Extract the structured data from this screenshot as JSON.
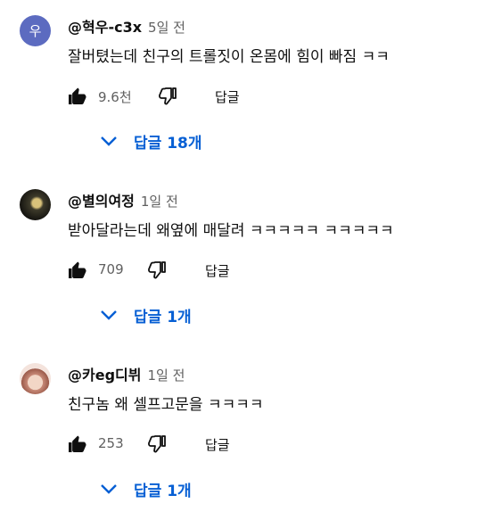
{
  "comments": [
    {
      "author": "@혁우-c3x",
      "time": "5일 전",
      "avatar_letter": "우",
      "text": "잘버텼는데 친구의 트롤짓이 온몸에 힘이 빠짐 ㅋㅋ",
      "likes": "9.6천",
      "reply_label": "답글",
      "replies_label": "답글 18개"
    },
    {
      "author": "@별의여정",
      "time": "1일 전",
      "text": "받아달라는데  왜옆에 매달려 ㅋㅋㅋㅋㅋ ㅋㅋㅋㅋㅋ",
      "likes": "709",
      "reply_label": "답글",
      "replies_label": "답글 1개"
    },
    {
      "author": "@카eg디뷔",
      "time": "1일 전",
      "text": "친구놈 왜 셀프고문을 ㅋㅋㅋㅋ",
      "likes": "253",
      "reply_label": "답글",
      "replies_label": "답글 1개"
    }
  ],
  "colors": {
    "link": "#065fd4",
    "meta": "#606060",
    "text": "#0f0f0f",
    "avatar_letter_bg": "#5c6bc0"
  }
}
